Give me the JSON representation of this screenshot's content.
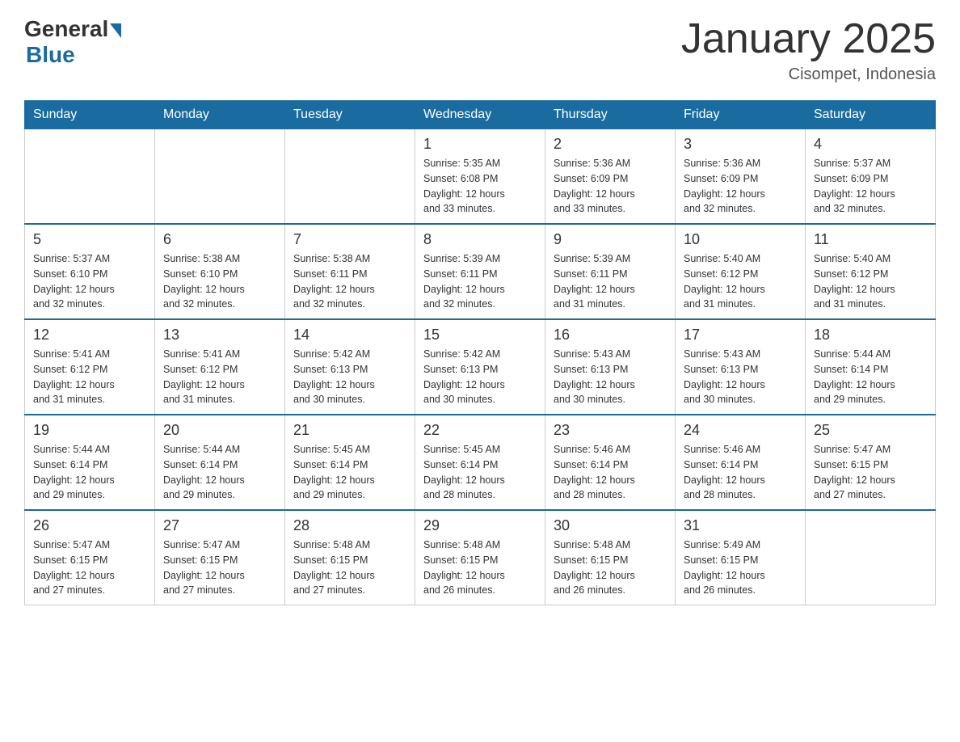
{
  "logo": {
    "general": "General",
    "blue": "Blue"
  },
  "title": "January 2025",
  "location": "Cisompet, Indonesia",
  "days_of_week": [
    "Sunday",
    "Monday",
    "Tuesday",
    "Wednesday",
    "Thursday",
    "Friday",
    "Saturday"
  ],
  "weeks": [
    [
      {
        "day": "",
        "info": ""
      },
      {
        "day": "",
        "info": ""
      },
      {
        "day": "",
        "info": ""
      },
      {
        "day": "1",
        "info": "Sunrise: 5:35 AM\nSunset: 6:08 PM\nDaylight: 12 hours\nand 33 minutes."
      },
      {
        "day": "2",
        "info": "Sunrise: 5:36 AM\nSunset: 6:09 PM\nDaylight: 12 hours\nand 33 minutes."
      },
      {
        "day": "3",
        "info": "Sunrise: 5:36 AM\nSunset: 6:09 PM\nDaylight: 12 hours\nand 32 minutes."
      },
      {
        "day": "4",
        "info": "Sunrise: 5:37 AM\nSunset: 6:09 PM\nDaylight: 12 hours\nand 32 minutes."
      }
    ],
    [
      {
        "day": "5",
        "info": "Sunrise: 5:37 AM\nSunset: 6:10 PM\nDaylight: 12 hours\nand 32 minutes."
      },
      {
        "day": "6",
        "info": "Sunrise: 5:38 AM\nSunset: 6:10 PM\nDaylight: 12 hours\nand 32 minutes."
      },
      {
        "day": "7",
        "info": "Sunrise: 5:38 AM\nSunset: 6:11 PM\nDaylight: 12 hours\nand 32 minutes."
      },
      {
        "day": "8",
        "info": "Sunrise: 5:39 AM\nSunset: 6:11 PM\nDaylight: 12 hours\nand 32 minutes."
      },
      {
        "day": "9",
        "info": "Sunrise: 5:39 AM\nSunset: 6:11 PM\nDaylight: 12 hours\nand 31 minutes."
      },
      {
        "day": "10",
        "info": "Sunrise: 5:40 AM\nSunset: 6:12 PM\nDaylight: 12 hours\nand 31 minutes."
      },
      {
        "day": "11",
        "info": "Sunrise: 5:40 AM\nSunset: 6:12 PM\nDaylight: 12 hours\nand 31 minutes."
      }
    ],
    [
      {
        "day": "12",
        "info": "Sunrise: 5:41 AM\nSunset: 6:12 PM\nDaylight: 12 hours\nand 31 minutes."
      },
      {
        "day": "13",
        "info": "Sunrise: 5:41 AM\nSunset: 6:12 PM\nDaylight: 12 hours\nand 31 minutes."
      },
      {
        "day": "14",
        "info": "Sunrise: 5:42 AM\nSunset: 6:13 PM\nDaylight: 12 hours\nand 30 minutes."
      },
      {
        "day": "15",
        "info": "Sunrise: 5:42 AM\nSunset: 6:13 PM\nDaylight: 12 hours\nand 30 minutes."
      },
      {
        "day": "16",
        "info": "Sunrise: 5:43 AM\nSunset: 6:13 PM\nDaylight: 12 hours\nand 30 minutes."
      },
      {
        "day": "17",
        "info": "Sunrise: 5:43 AM\nSunset: 6:13 PM\nDaylight: 12 hours\nand 30 minutes."
      },
      {
        "day": "18",
        "info": "Sunrise: 5:44 AM\nSunset: 6:14 PM\nDaylight: 12 hours\nand 29 minutes."
      }
    ],
    [
      {
        "day": "19",
        "info": "Sunrise: 5:44 AM\nSunset: 6:14 PM\nDaylight: 12 hours\nand 29 minutes."
      },
      {
        "day": "20",
        "info": "Sunrise: 5:44 AM\nSunset: 6:14 PM\nDaylight: 12 hours\nand 29 minutes."
      },
      {
        "day": "21",
        "info": "Sunrise: 5:45 AM\nSunset: 6:14 PM\nDaylight: 12 hours\nand 29 minutes."
      },
      {
        "day": "22",
        "info": "Sunrise: 5:45 AM\nSunset: 6:14 PM\nDaylight: 12 hours\nand 28 minutes."
      },
      {
        "day": "23",
        "info": "Sunrise: 5:46 AM\nSunset: 6:14 PM\nDaylight: 12 hours\nand 28 minutes."
      },
      {
        "day": "24",
        "info": "Sunrise: 5:46 AM\nSunset: 6:14 PM\nDaylight: 12 hours\nand 28 minutes."
      },
      {
        "day": "25",
        "info": "Sunrise: 5:47 AM\nSunset: 6:15 PM\nDaylight: 12 hours\nand 27 minutes."
      }
    ],
    [
      {
        "day": "26",
        "info": "Sunrise: 5:47 AM\nSunset: 6:15 PM\nDaylight: 12 hours\nand 27 minutes."
      },
      {
        "day": "27",
        "info": "Sunrise: 5:47 AM\nSunset: 6:15 PM\nDaylight: 12 hours\nand 27 minutes."
      },
      {
        "day": "28",
        "info": "Sunrise: 5:48 AM\nSunset: 6:15 PM\nDaylight: 12 hours\nand 27 minutes."
      },
      {
        "day": "29",
        "info": "Sunrise: 5:48 AM\nSunset: 6:15 PM\nDaylight: 12 hours\nand 26 minutes."
      },
      {
        "day": "30",
        "info": "Sunrise: 5:48 AM\nSunset: 6:15 PM\nDaylight: 12 hours\nand 26 minutes."
      },
      {
        "day": "31",
        "info": "Sunrise: 5:49 AM\nSunset: 6:15 PM\nDaylight: 12 hours\nand 26 minutes."
      },
      {
        "day": "",
        "info": ""
      }
    ]
  ]
}
